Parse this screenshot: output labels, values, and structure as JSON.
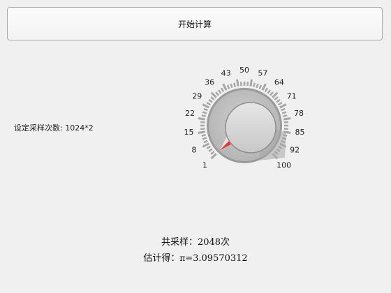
{
  "toolbar": {
    "start_label": "开始计算"
  },
  "settings": {
    "sample_label": "设定采样次数: 1024*2"
  },
  "knob": {
    "min": 1,
    "max": 100,
    "value": 1,
    "tick_labels": [
      "1",
      "8",
      "15",
      "22",
      "29",
      "36",
      "43",
      "50",
      "57",
      "64",
      "71",
      "78",
      "85",
      "92",
      "100"
    ],
    "pointer_color": "#e03a3a"
  },
  "results": {
    "total_label": "共采样：2048次",
    "estimate_prefix": "估计得：",
    "pi_symbol": "π",
    "estimate_value": "=3.09570312"
  }
}
